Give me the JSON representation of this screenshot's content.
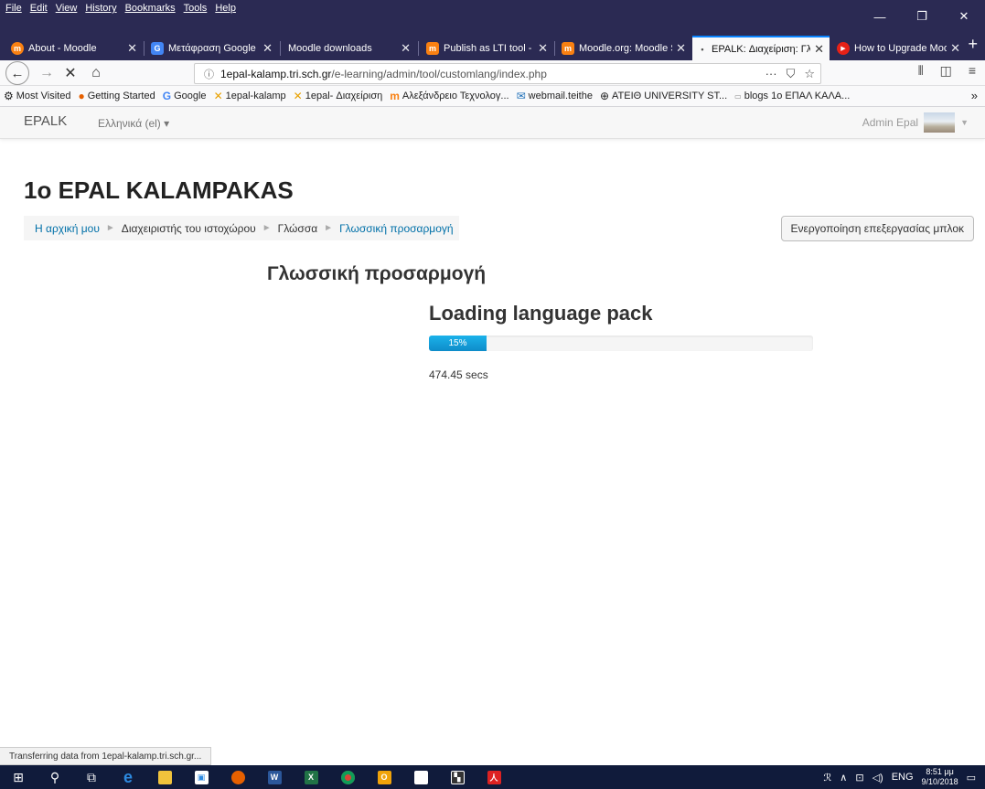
{
  "menubar": {
    "items": [
      "File",
      "Edit",
      "View",
      "History",
      "Bookmarks",
      "Tools",
      "Help"
    ]
  },
  "tabs": [
    {
      "title": "About - Moodle",
      "color": "#f98012",
      "glyph": "m"
    },
    {
      "title": "Μετάφραση Google",
      "color": "#4285f4",
      "glyph": "G"
    },
    {
      "title": "Moodle downloads",
      "color": "",
      "glyph": ""
    },
    {
      "title": "Publish as LTI tool - M",
      "color": "#f98012",
      "glyph": "m"
    },
    {
      "title": "Moodle.org: Moodle S",
      "color": "#f98012",
      "glyph": "m"
    },
    {
      "title": "EPALK: Διαχείριση: Γλω",
      "color": "",
      "glyph": "•"
    },
    {
      "title": "How to Upgrade Moo",
      "color": "#e62117",
      "glyph": "▶"
    }
  ],
  "url": {
    "host": "1epal-kalamp.tri.sch.gr",
    "path": "/e-learning/admin/tool/customlang/index.php"
  },
  "bookmarks": [
    {
      "label": "Most Visited",
      "icon": "gear-icon"
    },
    {
      "label": "Getting Started",
      "icon": "firefox-icon"
    },
    {
      "label": "Google",
      "icon": "google-icon"
    },
    {
      "label": "1epal-kalamp",
      "icon": "joomla-icon"
    },
    {
      "label": "1epal- Διαχείριση",
      "icon": "joomla-icon"
    },
    {
      "label": "Αλεξάνδρειο Τεχνολογ...",
      "icon": "moodle-icon"
    },
    {
      "label": "webmail.teithe",
      "icon": "mail-icon"
    },
    {
      "label": "ATEIΘ UNIVERSITY ST...",
      "icon": "globe-icon"
    },
    {
      "label": "blogs 1ο ΕΠΑΛ ΚΑΛΑ...",
      "icon": "blog-icon"
    }
  ],
  "moodle": {
    "brand": "EPALK",
    "language": "Ελληνικά (el) ▾",
    "user": "Admin Epal",
    "site_title": "1o EPAL KALAMPAKAS",
    "breadcrumb": [
      "Η αρχική μου",
      "Διαχειριστής του ιστοχώρου",
      "Γλώσσα",
      "Γλωσσική προσαρμογή"
    ],
    "block_button": "Ενεργοποίηση επεξεργασίας μπλοκ",
    "page_heading": "Γλωσσική προσαρμογή",
    "loading_title": "Loading language pack",
    "progress": {
      "percent": 15,
      "label": "15%"
    },
    "elapsed": "474.45 secs"
  },
  "status": "Transferring data from 1epal-kalamp.tri.sch.gr...",
  "tray": {
    "lang": "ENG",
    "time": "8:51 μμ",
    "date": "9/10/2018"
  }
}
